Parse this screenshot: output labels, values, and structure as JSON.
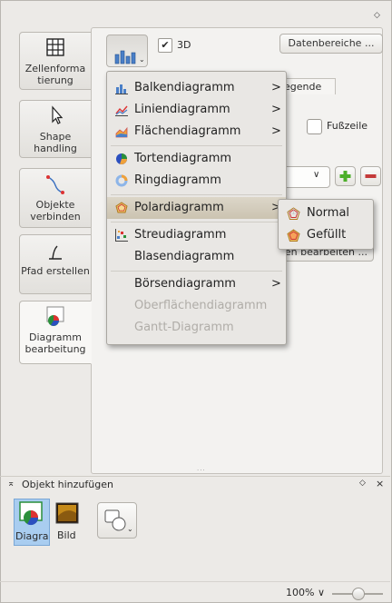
{
  "toolbox": {
    "tabs": [
      {
        "label": "Zellenforma tierung",
        "icon": "table-grid-icon"
      },
      {
        "label": "Shape handling",
        "icon": "cursor-arrow-icon"
      },
      {
        "label": "Objekte verbinden",
        "icon": "connector-icon"
      },
      {
        "label": "Pfad erstellen",
        "icon": "path-curve-icon"
      },
      {
        "label": "Diagramm bearbeitung",
        "icon": "chart-edit-icon"
      }
    ]
  },
  "chart_panel": {
    "three_d_label": "3D",
    "three_d_checked": true,
    "data_ranges_button": "Datenbereiche ...",
    "legend_tab": "egende",
    "footer_label": "Fußzeile",
    "edit_button": "en bearbeiten ..."
  },
  "chart_type_menu": {
    "items": [
      {
        "label": "Balkendiagramm",
        "icon": "bar-chart-icon",
        "submenu": true,
        "enabled": true
      },
      {
        "label": "Liniendiagramm",
        "icon": "line-chart-icon",
        "submenu": true,
        "enabled": true
      },
      {
        "label": "Flächendiagramm",
        "icon": "area-chart-icon",
        "submenu": true,
        "enabled": true
      },
      {
        "label": "Tortendiagramm",
        "icon": "pie-chart-icon",
        "submenu": false,
        "enabled": true
      },
      {
        "label": "Ringdiagramm",
        "icon": "ring-chart-icon",
        "submenu": false,
        "enabled": true
      },
      {
        "label": "Polardiagramm",
        "icon": "polar-chart-icon",
        "submenu": true,
        "enabled": true,
        "highlighted": true
      },
      {
        "label": "Streudiagramm",
        "icon": "scatter-chart-icon",
        "submenu": false,
        "enabled": true
      },
      {
        "label": "Blasendiagramm",
        "icon": "",
        "submenu": false,
        "enabled": true
      },
      {
        "label": "Börsendiagramm",
        "icon": "",
        "submenu": true,
        "enabled": true
      },
      {
        "label": "Oberflächendiagramm",
        "icon": "",
        "submenu": false,
        "enabled": false
      },
      {
        "label": "Gantt-Diagramm",
        "icon": "",
        "submenu": false,
        "enabled": false
      }
    ],
    "arrow_glyph": ">"
  },
  "polar_submenu": {
    "items": [
      {
        "label": "Normal",
        "icon": "polar-normal-icon"
      },
      {
        "label": "Gefüllt",
        "icon": "polar-filled-icon"
      }
    ]
  },
  "add_object_panel": {
    "title": "Objekt hinzufügen",
    "items": [
      {
        "label": "Diagra",
        "icon": "chart-insert-icon",
        "selected": true
      },
      {
        "label": "Bild",
        "icon": "image-insert-icon",
        "selected": false
      }
    ]
  },
  "status_bar": {
    "zoom": "100% ∨"
  },
  "colors": {
    "accent_green": "#4caf2a",
    "highlight": "#cbc3b1",
    "selection_blue": "#a9cdf0"
  }
}
